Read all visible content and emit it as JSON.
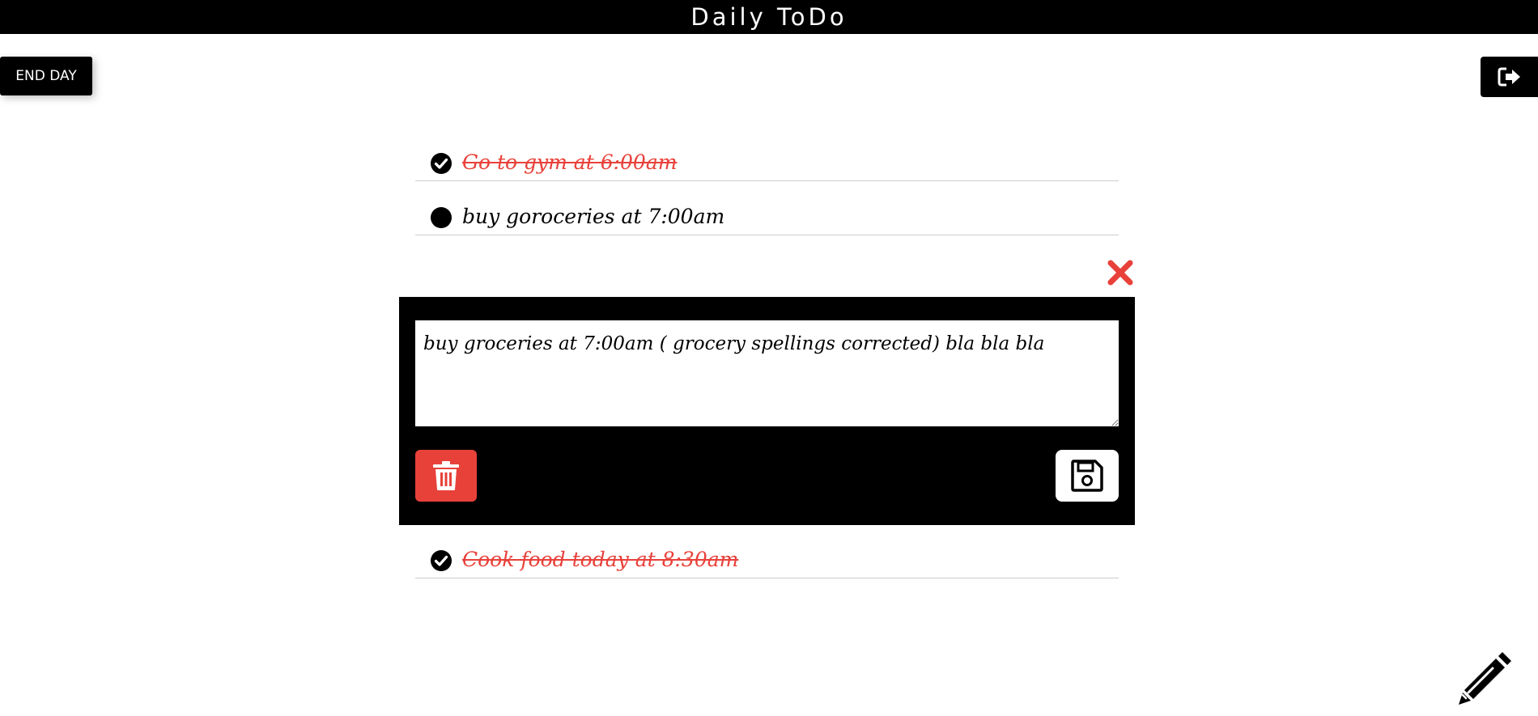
{
  "app": {
    "title": "Daily ToDo"
  },
  "toolbar": {
    "end_day_label": "END DAY",
    "logout_icon": "sign-out-icon"
  },
  "todos": [
    {
      "text": "Go to gym at 6:00am",
      "status": "done",
      "icon": "check-circle-icon"
    },
    {
      "text": "buy goroceries at 7:00am",
      "status": "pending",
      "icon": "circle-icon"
    },
    {
      "text": "Cook food today at 8:30am",
      "status": "done",
      "icon": "check-circle-icon"
    }
  ],
  "editor": {
    "value": "buy groceries at 7:00am ( grocery spellings corrected) bla bla bla",
    "close_icon": "close-icon",
    "delete_icon": "trash-icon",
    "save_icon": "save-icon"
  },
  "fab": {
    "icon": "pencil-icon"
  },
  "colors": {
    "accent_red": "#e8413a",
    "header_bg": "#000000",
    "divider": "#cccccc"
  }
}
